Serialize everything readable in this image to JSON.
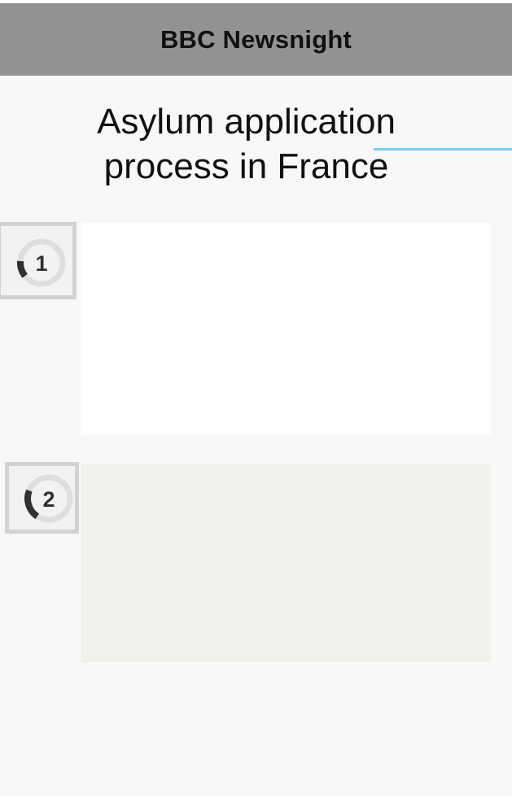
{
  "header": {
    "title": "BBC Newsnight"
  },
  "article": {
    "title_lines": [
      "Asylum application",
      "process in France"
    ]
  },
  "steps": [
    {
      "number": "1",
      "progress_fraction": 0.12
    },
    {
      "number": "2",
      "progress_fraction": 0.22
    }
  ],
  "colors": {
    "header_bg": "#929292",
    "accent_line": "#6fd0ee",
    "badge_border": "#d2d2d2",
    "progress_arc": "#2f332f",
    "progress_track": "#dedede"
  }
}
